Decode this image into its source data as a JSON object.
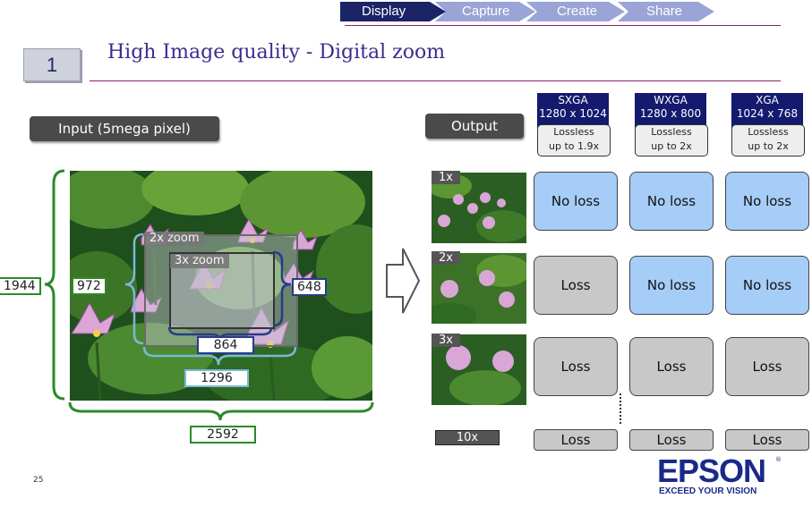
{
  "nav": {
    "items": [
      "Display",
      "Capture",
      "Create",
      "Share"
    ],
    "active_color": "#1a2466",
    "inactive_color": "#9aa4d6"
  },
  "slide": {
    "number": "1",
    "title": "High Image quality  - Digital zoom",
    "page_number": "25"
  },
  "input": {
    "label": "Input (5mega pixel)",
    "zoom2_label": "2x zoom",
    "zoom3_label": "3x zoom",
    "dim_1944": "1944",
    "dim_972": "972",
    "dim_648": "648",
    "dim_864": "864",
    "dim_1296": "1296",
    "dim_2592": "2592"
  },
  "output": {
    "label": "Output",
    "rows": [
      "1x",
      "2x",
      "3x",
      "10x"
    ],
    "ellipsis": "…"
  },
  "columns": [
    {
      "name": "SXGA",
      "res": "1280 x 1024",
      "lossless": "Lossless",
      "upto": "up to 1.9x"
    },
    {
      "name": "WXGA",
      "res": "1280 x 800",
      "lossless": "Lossless",
      "upto": "up to 2x"
    },
    {
      "name": "XGA",
      "res": "1024 x 768",
      "lossless": "Lossless",
      "upto": "up to 2x"
    }
  ],
  "grid": [
    [
      "No loss",
      "No loss",
      "No loss"
    ],
    [
      "Loss",
      "No loss",
      "No loss"
    ],
    [
      "Loss",
      "Loss",
      "Loss"
    ],
    [
      "Loss",
      "Loss",
      "Loss"
    ]
  ],
  "brand": {
    "name": "EPSON",
    "registered": "®",
    "tagline": "EXCEED YOUR VISION",
    "color": "#1a2a8a"
  }
}
